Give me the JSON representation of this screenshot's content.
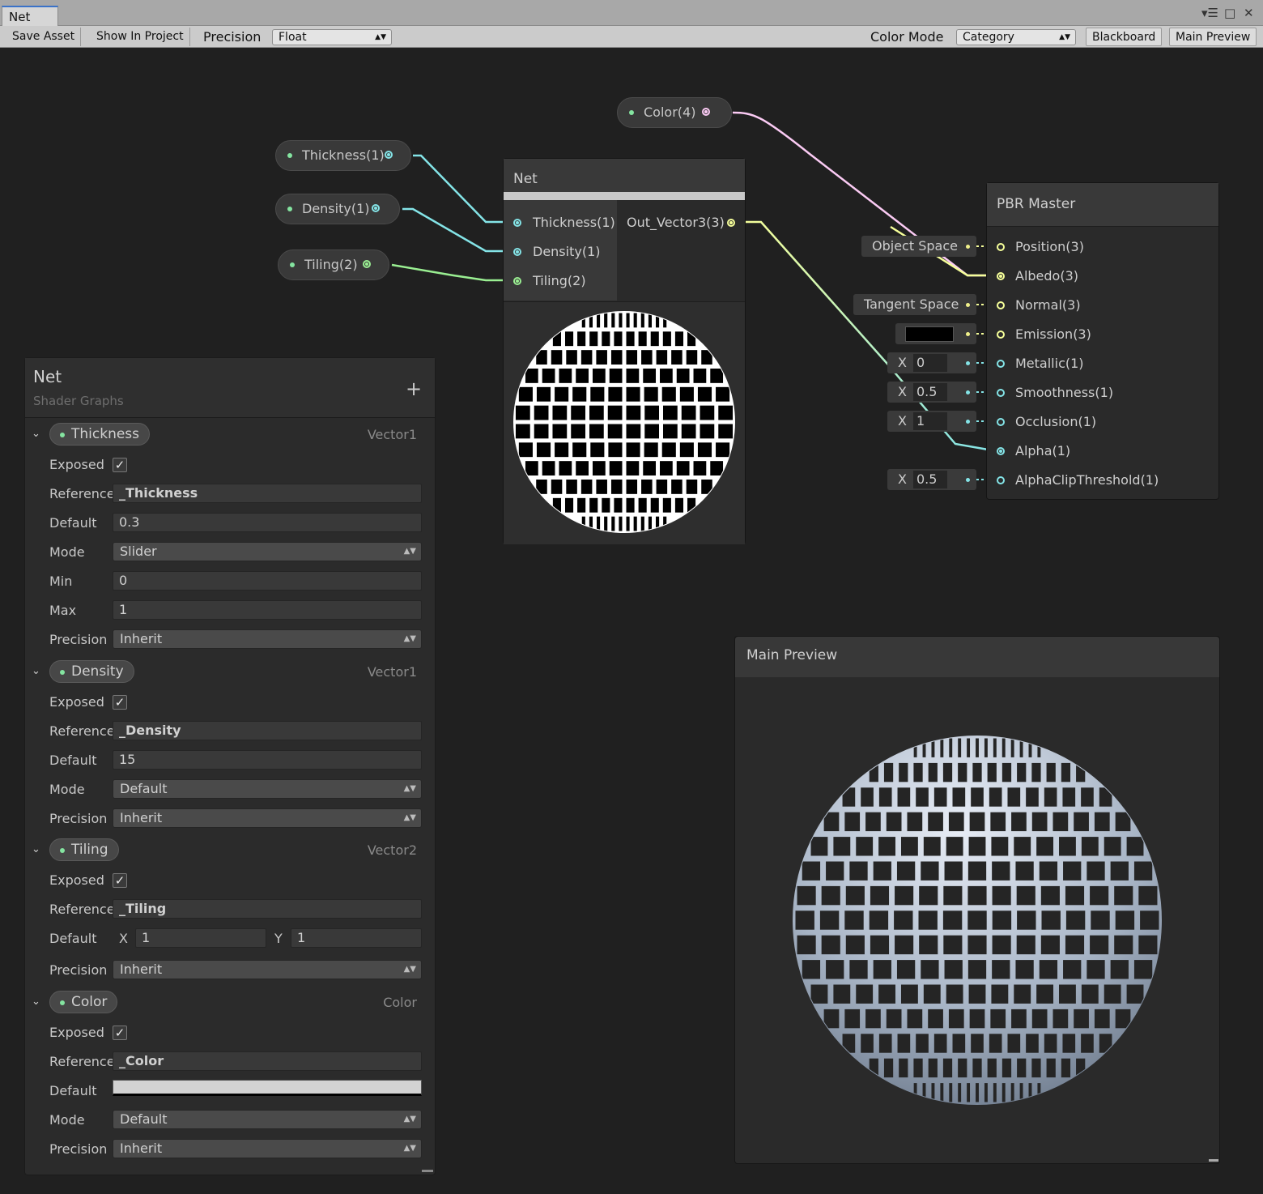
{
  "window": {
    "tab_title": "Net"
  },
  "toolbar": {
    "save_asset": "Save Asset",
    "show_in_project": "Show In Project",
    "precision_label": "Precision",
    "precision_value": "Float",
    "color_mode_label": "Color Mode",
    "color_mode_value": "Category",
    "blackboard": "Blackboard",
    "main_preview": "Main Preview"
  },
  "graph": {
    "property_nodes": {
      "color": "Color(4)",
      "thickness": "Thickness(1)",
      "density": "Density(1)",
      "tiling": "Tiling(2)"
    },
    "net_node": {
      "title": "Net",
      "inputs": [
        "Thickness(1)",
        "Density(1)",
        "Tiling(2)"
      ],
      "output": "Out_Vector3(3)"
    },
    "pbr_master": {
      "title": "PBR Master",
      "slots": [
        "Position(3)",
        "Albedo(3)",
        "Normal(3)",
        "Emission(3)",
        "Metallic(1)",
        "Smoothness(1)",
        "Occlusion(1)",
        "Alpha(1)",
        "AlphaClipThreshold(1)"
      ],
      "inline": {
        "position_space": "Object Space",
        "normal_space": "Tangent Space",
        "metallic": "0",
        "smoothness": "0.5",
        "occlusion": "1",
        "alpha_clip": "0.5",
        "x_label": "X"
      }
    },
    "wire_colors": {
      "vector1": "#84e4e7",
      "vector2": "#9aef92",
      "vector3": "#f6ff9a",
      "vector4": "#fbcbf4"
    }
  },
  "blackboard": {
    "title": "Net",
    "subtitle": "Shader Graphs",
    "add": "+",
    "labels": {
      "exposed": "Exposed",
      "reference": "Reference",
      "default": "Default",
      "mode": "Mode",
      "min": "Min",
      "max": "Max",
      "precision": "Precision",
      "x": "X",
      "y": "Y"
    },
    "properties": {
      "thickness": {
        "name": "Thickness",
        "type": "Vector1",
        "exposed": true,
        "reference": "_Thickness",
        "default": "0.3",
        "mode": "Slider",
        "min": "0",
        "max": "1",
        "precision": "Inherit"
      },
      "density": {
        "name": "Density",
        "type": "Vector1",
        "exposed": true,
        "reference": "_Density",
        "default": "15",
        "mode": "Default",
        "precision": "Inherit"
      },
      "tiling": {
        "name": "Tiling",
        "type": "Vector2",
        "exposed": true,
        "reference": "_Tiling",
        "default_x": "1",
        "default_y": "1",
        "precision": "Inherit"
      },
      "color": {
        "name": "Color",
        "type": "Color",
        "exposed": true,
        "reference": "_Color",
        "default_color": "#d2d2d2",
        "mode": "Default",
        "precision": "Inherit"
      }
    }
  },
  "main_preview": {
    "title": "Main Preview"
  }
}
